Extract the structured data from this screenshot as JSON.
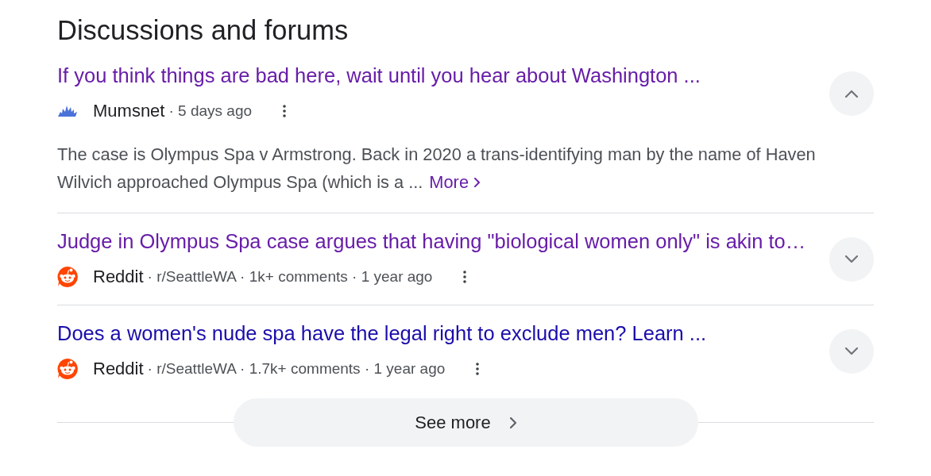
{
  "heading": "Discussions and forums",
  "threads": [
    {
      "title": "If you think things are bad here, wait until you hear about Washington ...",
      "visited": true,
      "expanded": true,
      "source": {
        "kind": "splash",
        "name": "Mumsnet",
        "details": "· 5 days ago"
      },
      "snippet": "The case is Olympus Spa v Armstrong. Back in 2020 a trans-identifying man by the name of Haven Wilvich approached Olympus Spa (which is a ...",
      "more_link": "More"
    },
    {
      "title": "Judge in Olympus Spa case argues that having \"biological women only\" is akin to…",
      "visited": true,
      "expanded": false,
      "source": {
        "kind": "alien",
        "name": "Reddit",
        "details": "· r/SeattleWA · 1k+ comments · 1 year ago"
      }
    },
    {
      "title": "Does a women's nude spa have the legal right to exclude men? Learn ...",
      "visited": false,
      "expanded": false,
      "source": {
        "kind": "alien",
        "name": "Reddit",
        "details": "· r/SeattleWA · 1.7k+ comments · 1 year ago"
      }
    }
  ],
  "see_more": "See more"
}
